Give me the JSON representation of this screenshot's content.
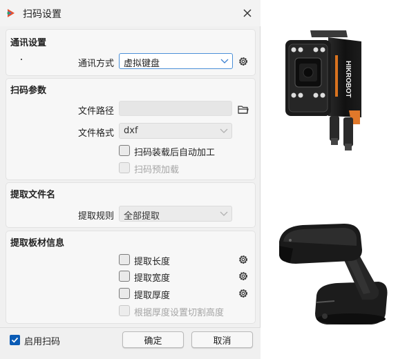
{
  "window": {
    "title": "扫码设置"
  },
  "comm": {
    "title": "通讯设置",
    "method_label": "通讯方式",
    "method_value": "虚拟键盘"
  },
  "scan": {
    "title": "扫码参数",
    "path_label": "文件路径",
    "path_value": "",
    "format_label": "文件格式",
    "format_value": "dxf",
    "auto_process_label": "扫码装载后自动加工",
    "preload_label": "扫码预加载"
  },
  "extract_file": {
    "title": "提取文件名",
    "rule_label": "提取规则",
    "rule_value": "全部提取"
  },
  "extract_board": {
    "title": "提取板材信息",
    "length_label": "提取长度",
    "width_label": "提取宽度",
    "thickness_label": "提取厚度",
    "cut_height_label": "根据厚度设置切割高度"
  },
  "footer": {
    "enable_label": "启用扫码",
    "ok_label": "确定",
    "cancel_label": "取消"
  },
  "images": {
    "camera_brand": "HIKROBOT"
  },
  "colors": {
    "accent": "#0a5bb5",
    "focus_border": "#4a8fd8"
  }
}
